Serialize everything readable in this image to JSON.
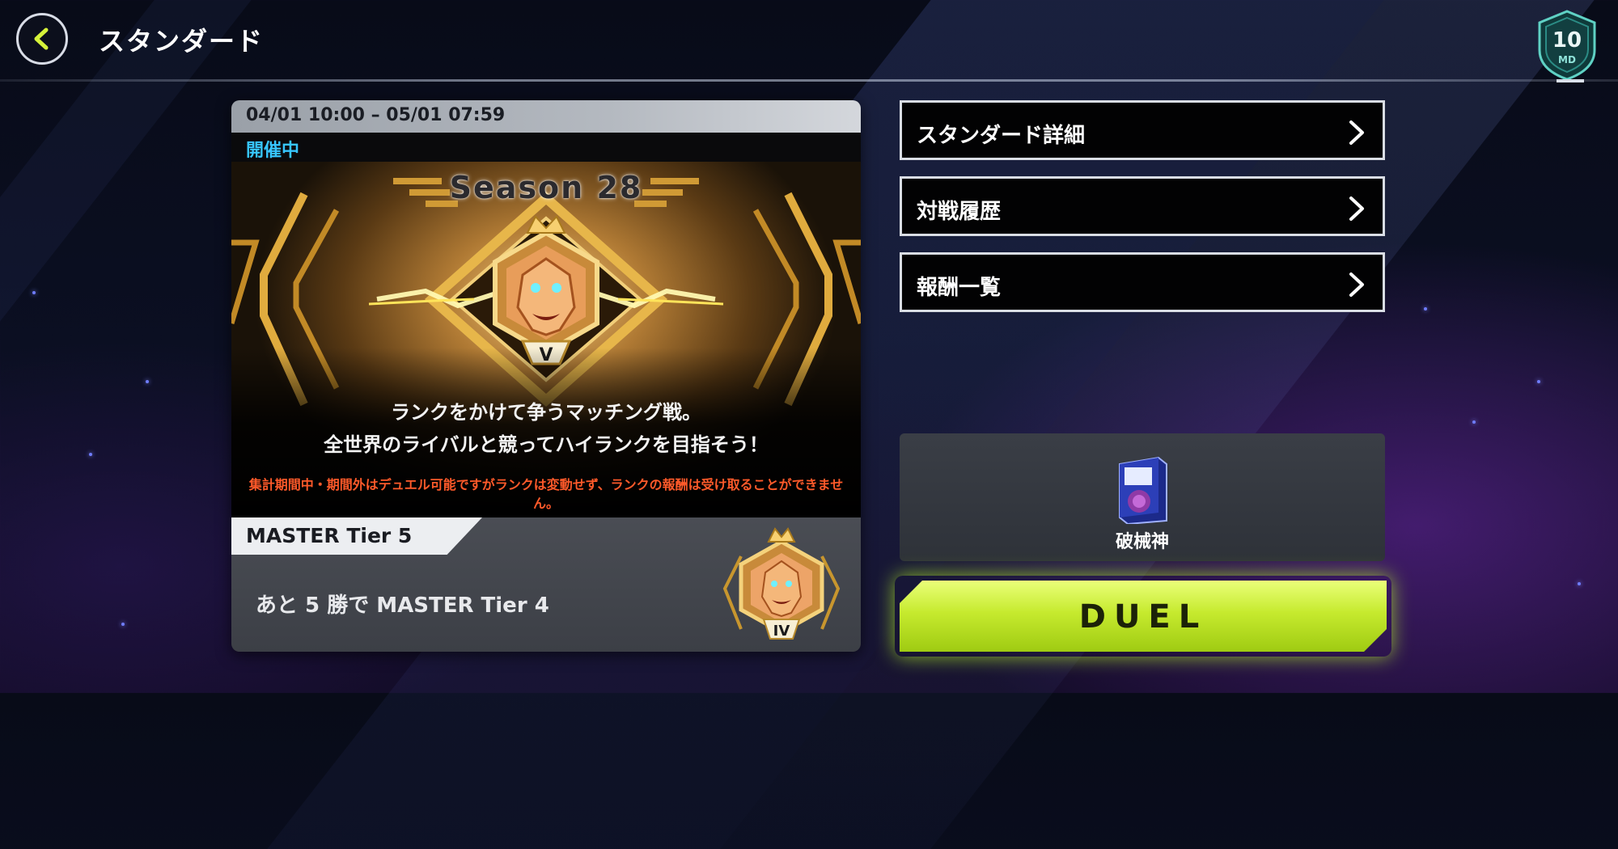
{
  "header": {
    "title": "スタンダード",
    "rank_badge": {
      "level": "10",
      "abbr": "MD"
    }
  },
  "season_card": {
    "period": "04/01 10:00 – 05/01 07:59",
    "status": "開催中",
    "season_title": "Season 28",
    "emblem_grade": "V",
    "tagline_line1": "ランクをかけて争うマッチング戦。",
    "tagline_line2": "全世界のライバルと競ってハイランクを目指そう！",
    "notice": "集計期間中・期間外はデュエル可能ですがランクは変動せず、ランクの報酬は受け取ることができません。",
    "current_tier": "MASTER Tier 5",
    "progress_text": "あと 5 勝で  MASTER Tier 4",
    "next_tier_grade": "IV"
  },
  "menu": {
    "items": [
      {
        "label": "スタンダード詳細"
      },
      {
        "label": "対戦履歴"
      },
      {
        "label": "報酬一覧"
      }
    ]
  },
  "deck": {
    "name": "破械神"
  },
  "duel_button": {
    "label": "DUEL"
  },
  "colors": {
    "accent_lime": "#c6ea2e",
    "status_blue": "#37c6ff",
    "notice_red": "#ff5a2a",
    "back_arrow": "#d6f23a"
  },
  "icons": {
    "back": "chevron-left-icon",
    "menu_arrow": "chevron-right-icon",
    "deck": "deck-box-icon",
    "rank": "rank-emblem-icon"
  }
}
